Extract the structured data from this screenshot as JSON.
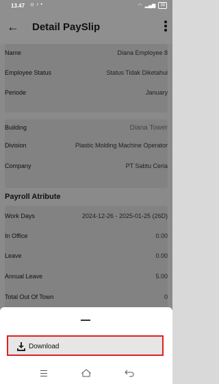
{
  "status_bar": {
    "time": "13.47",
    "battery": "39"
  },
  "app_bar": {
    "title": "Detail PaySlip"
  },
  "employee": {
    "name_label": "Name",
    "name_value": "Diana Employee 8",
    "status_label": "Employee Status",
    "status_value": "Status Tidak Diketahui",
    "period_label": "Periode",
    "period_value": "January"
  },
  "company_info": {
    "building_label": "Building",
    "building_value": "Diana Tower",
    "division_label": "Division",
    "division_value": "Plastic Molding Machine Operator",
    "company_label": "Company",
    "company_value": "PT Sabtu Ceria"
  },
  "payroll": {
    "section_title": "Payroll Atribute",
    "rows": [
      {
        "label": "Work Days",
        "value": "2024-12-26 - 2025-01-25 (26D)"
      },
      {
        "label": "In Office",
        "value": "0.00"
      },
      {
        "label": "Leave",
        "value": "0.00"
      },
      {
        "label": "Annual Leave",
        "value": "5.00"
      },
      {
        "label": "Total Out Of Town",
        "value": "0"
      }
    ]
  },
  "sheet": {
    "download_label": "Download"
  },
  "colors": {
    "highlight_border": "#e02020",
    "overlay": "#8a8a8a"
  }
}
